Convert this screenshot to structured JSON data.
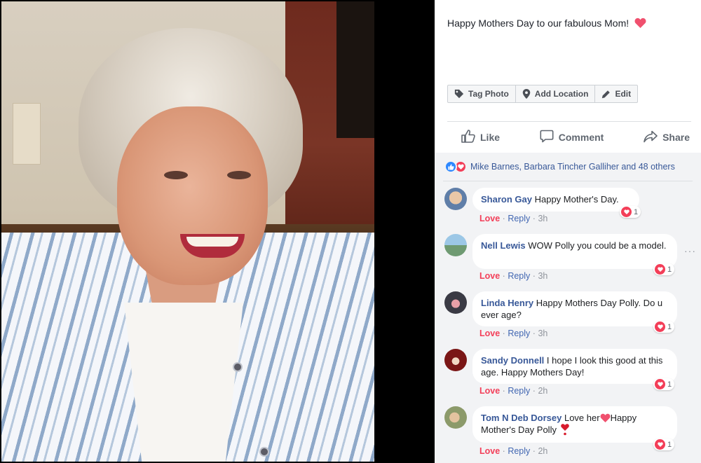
{
  "caption": {
    "text": "Happy Mothers Day to our fabulous Mom!",
    "emoji": "red-heart"
  },
  "photo_actions": [
    {
      "label": "Tag Photo",
      "icon": "tag-icon"
    },
    {
      "label": "Add Location",
      "icon": "location-pin-icon"
    },
    {
      "label": "Edit",
      "icon": "pencil-icon"
    }
  ],
  "reaction_bar": {
    "like": "Like",
    "comment": "Comment",
    "share": "Share"
  },
  "reactions_summary": {
    "reactors": "Mike Barnes, Barbara Tincher Galliher and 48 others"
  },
  "comments": [
    {
      "author": "Sharon Gay",
      "text": "Happy Mother's Day.",
      "love": "Love",
      "reply": "Reply",
      "time": "3h",
      "reactions": "1"
    },
    {
      "author": "Nell Lewis",
      "text": "WOW Polly you could be a model.",
      "love": "Love",
      "reply": "Reply",
      "time": "3h",
      "reactions": "1"
    },
    {
      "author": "Linda Henry",
      "text": "Happy Mothers Day Polly. Do u ever age?",
      "love": "Love",
      "reply": "Reply",
      "time": "3h",
      "reactions": "1"
    },
    {
      "author": "Sandy Donnell",
      "text": "I hope I look this good at this age. Happy Mothers Day!",
      "love": "Love",
      "reply": "Reply",
      "time": "2h",
      "reactions": "1"
    },
    {
      "author": "Tom N Deb Dorsey",
      "text_before": "Love her",
      "text_after": "Happy Mother's Day Polly",
      "love": "Love",
      "reply": "Reply",
      "time": "2h",
      "reactions": "1"
    }
  ],
  "colors": {
    "link": "#385898",
    "love": "#f33e58",
    "like": "#2d88ff",
    "background": "#f2f3f5"
  },
  "separator": "·"
}
